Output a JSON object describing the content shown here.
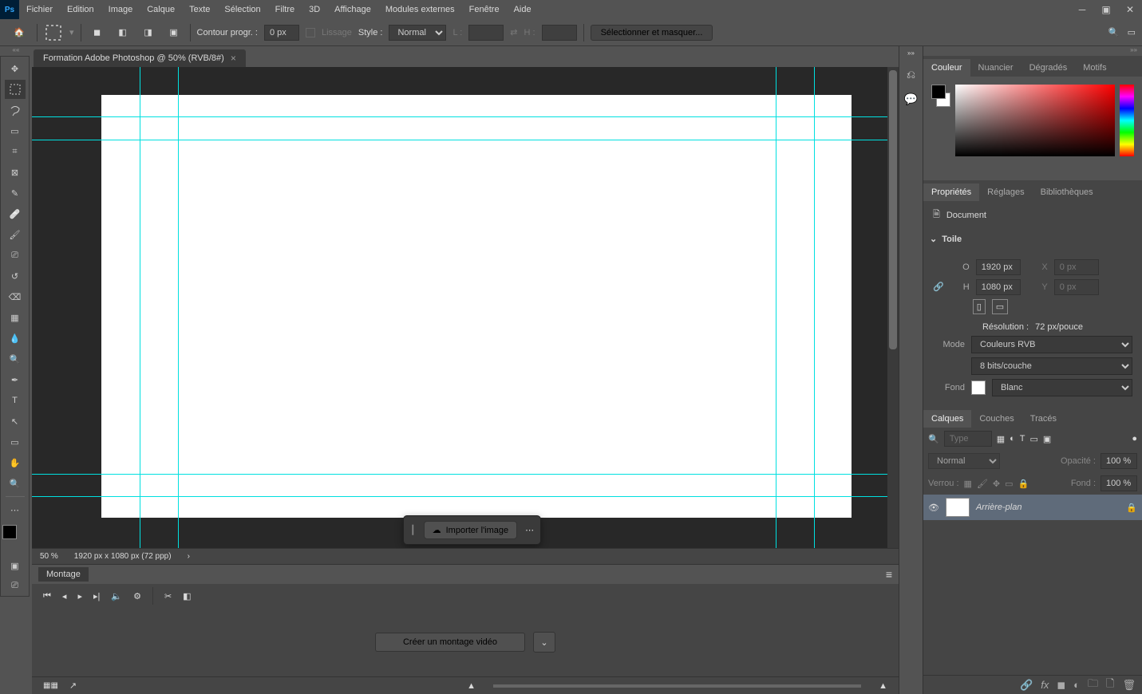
{
  "menubar": [
    "Fichier",
    "Edition",
    "Image",
    "Calque",
    "Texte",
    "Sélection",
    "Filtre",
    "3D",
    "Affichage",
    "Modules externes",
    "Fenêtre",
    "Aide"
  ],
  "app_icon": "Ps",
  "options": {
    "feather_label": "Contour progr. :",
    "feather_value": "0 px",
    "antialias_label": "Lissage",
    "style_label": "Style :",
    "style_value": "Normal",
    "width_label": "L :",
    "height_label": "H :",
    "select_mask": "Sélectionner et masquer...",
    "search_icon": "search-icon",
    "share_icon": "share-icon"
  },
  "doc_tab": "Formation Adobe Photoshop @ 50% (RVB/8#)",
  "import_label": "Importer l'image",
  "status": {
    "zoom": "50 %",
    "info": "1920 px x 1080 px (72 ppp)"
  },
  "timeline": {
    "tab": "Montage",
    "create": "Créer un montage vidéo"
  },
  "panels": {
    "color_tabs": [
      "Couleur",
      "Nuancier",
      "Dégradés",
      "Motifs"
    ],
    "prop_tabs": [
      "Propriétés",
      "Réglages",
      "Bibliothèques"
    ],
    "doc_label": "Document",
    "toile": "Toile",
    "width_l": "O",
    "width_v": "1920 px",
    "height_l": "H",
    "height_v": "1080 px",
    "x_l": "X",
    "x_v": "0 px",
    "y_l": "Y",
    "y_v": "0 px",
    "res_label": "Résolution :",
    "res_value": "72 px/pouce",
    "mode_label": "Mode",
    "mode_value": "Couleurs RVB",
    "depth_value": "8 bits/couche",
    "fond_label": "Fond",
    "fond_value": "Blanc",
    "layer_tabs": [
      "Calques",
      "Couches",
      "Tracés"
    ],
    "type_placeholder": "Type",
    "blend_mode": "Normal",
    "opacity_label": "Opacité :",
    "opacity_value": "100 %",
    "lock_label": "Verrou :",
    "fill_label": "Fond :",
    "fill_value": "100 %",
    "layer_name": "Arrière-plan"
  }
}
